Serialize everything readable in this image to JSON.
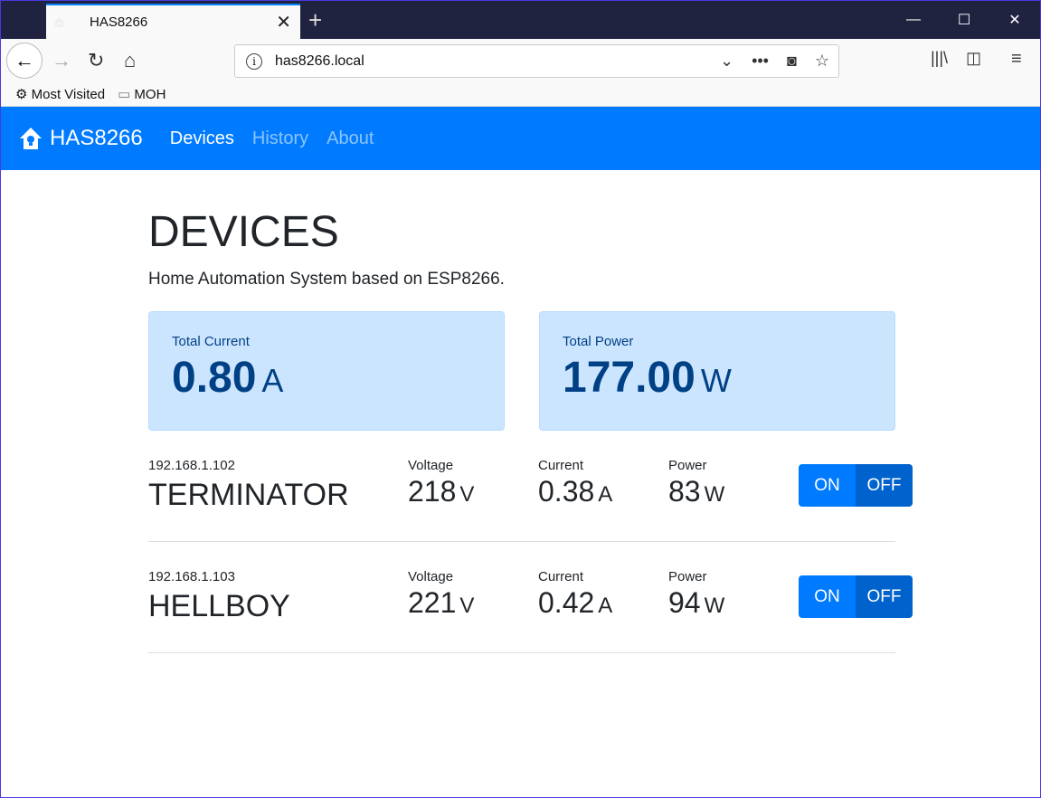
{
  "browser": {
    "tab_title": "HAS8266",
    "url": "has8266.local",
    "bookmarks": [
      "Most Visited",
      "MOH"
    ]
  },
  "app": {
    "brand": "HAS8266",
    "nav": [
      "Devices",
      "History",
      "About"
    ]
  },
  "page": {
    "title": "DEVICES",
    "lead": "Home Automation System based on ESP8266."
  },
  "totals": [
    {
      "label": "Total Current",
      "value": "0.80",
      "unit": "A"
    },
    {
      "label": "Total Power",
      "value": "177.00",
      "unit": "W"
    }
  ],
  "devices": [
    {
      "ip": "192.168.1.102",
      "name": "TERMINATOR",
      "voltage_label": "Voltage",
      "voltage": "218",
      "voltage_unit": "V",
      "current_label": "Current",
      "current": "0.38",
      "current_unit": "A",
      "power_label": "Power",
      "power": "83",
      "power_unit": "W",
      "on": "ON",
      "off": "OFF",
      "state": "off"
    },
    {
      "ip": "192.168.1.103",
      "name": "HELLBOY",
      "voltage_label": "Voltage",
      "voltage": "221",
      "voltage_unit": "V",
      "current_label": "Current",
      "current": "0.42",
      "current_unit": "A",
      "power_label": "Power",
      "power": "94",
      "power_unit": "W",
      "on": "ON",
      "off": "OFF",
      "state": "off"
    }
  ]
}
